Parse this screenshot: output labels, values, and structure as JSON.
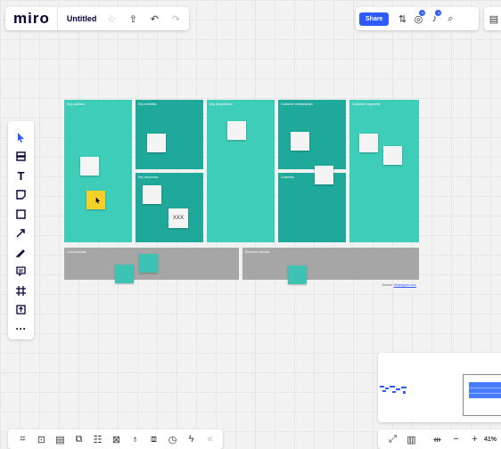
{
  "app": {
    "logo_text": "miro",
    "board_title": "Untitled"
  },
  "topbar": {
    "share_label": "Share",
    "collaborator_badge": "5",
    "notification_badge": "3"
  },
  "canvas": {
    "blocks": [
      {
        "label": "Key partners"
      },
      {
        "label": "Key activities"
      },
      {
        "label": "Key resources"
      },
      {
        "label": "Key propositions"
      },
      {
        "label": "Customer relationships"
      },
      {
        "label": "Channels"
      },
      {
        "label": "Customer segments"
      },
      {
        "label": "Cost structure"
      },
      {
        "label": "Revenue streams"
      }
    ],
    "note_text": "XXX",
    "source_prefix": "Source: ",
    "source_link": "Strategyzer.com"
  },
  "zoom": {
    "level": "41%"
  },
  "colors": {
    "accent": "#2d5bff",
    "teal": "#3ecdb8",
    "teal_dark": "#1fa99a",
    "gray": "#a6a6a6",
    "sticky_yellow": "#f5d128"
  },
  "icons": {
    "left_toolbar": [
      "select-cursor-icon",
      "templates-icon",
      "text-icon",
      "sticky-note-icon",
      "shape-icon",
      "arrow-icon",
      "pen-icon",
      "comment-icon",
      "frame-icon",
      "upload-icon",
      "more-icon"
    ],
    "bottom_toolbar": [
      "frames-icon",
      "comments-icon",
      "chat-icon",
      "cards-icon",
      "kanban-icon",
      "mind-map-icon",
      "voting-icon",
      "video-chat-icon",
      "timer-icon",
      "activity-icon",
      "collapse-icon"
    ]
  }
}
